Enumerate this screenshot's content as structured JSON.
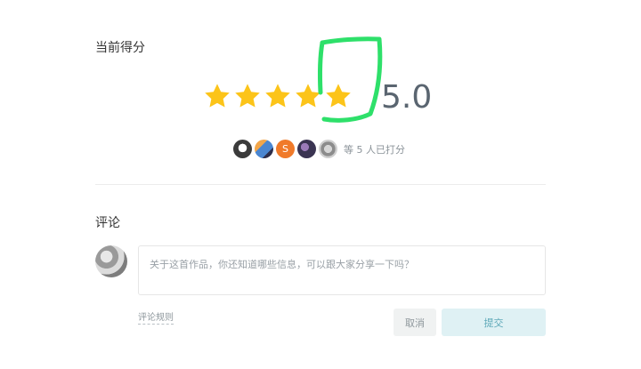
{
  "rating": {
    "section_title": "当前得分",
    "score": "5.0",
    "stars_filled": 5,
    "stars_total": 5,
    "raters_text": "等 5 人已打分",
    "rater_avatars": [
      {
        "name": "avatar-1",
        "letter": ""
      },
      {
        "name": "avatar-2",
        "letter": ""
      },
      {
        "name": "avatar-3",
        "letter": "S"
      },
      {
        "name": "avatar-4",
        "letter": ""
      },
      {
        "name": "avatar-5",
        "letter": ""
      }
    ]
  },
  "comment": {
    "section_title": "评论",
    "placeholder": "关于这首作品，你还知道哪些信息，可以跟大家分享一下吗？",
    "rules_link": "评论规则",
    "cancel_label": "取消",
    "submit_label": "提交"
  },
  "colors": {
    "star": "#fcc419",
    "annotation": "#2ee06a",
    "submit_bg": "#dff1f4",
    "submit_text": "#5fa9b9"
  }
}
